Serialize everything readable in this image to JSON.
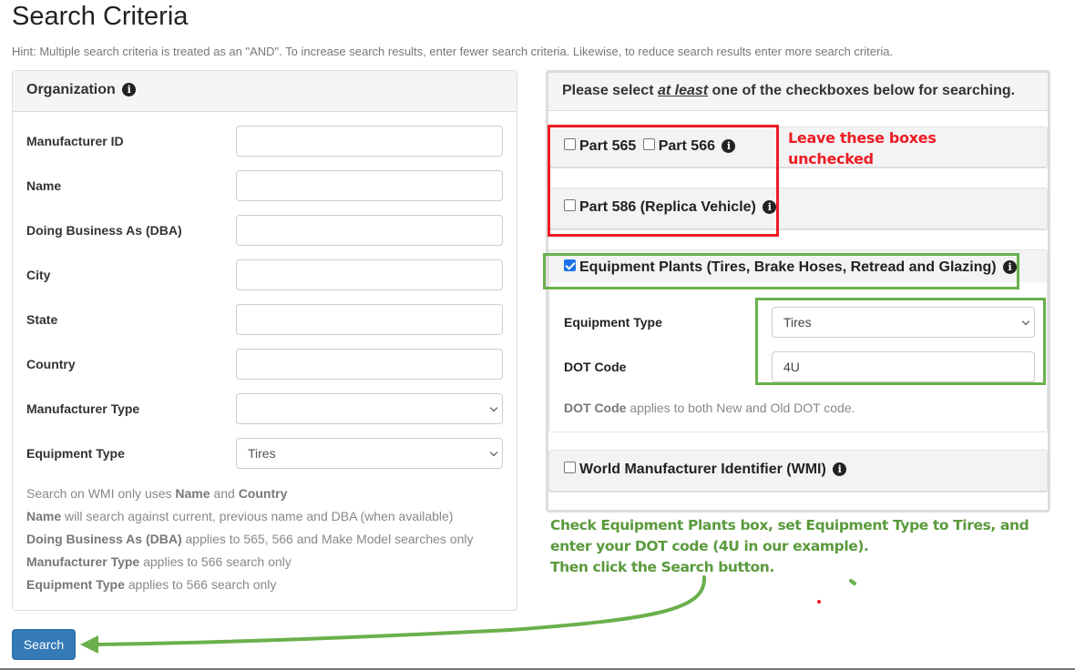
{
  "page": {
    "title": "Search Criteria",
    "hint": "Hint: Multiple search criteria is treated as an \"AND\". To increase search results, enter fewer search criteria. Likewise, to reduce search results enter more search criteria."
  },
  "organization": {
    "heading": "Organization",
    "info_icon": "info-circle-icon",
    "fields": [
      {
        "label": "Manufacturer ID",
        "type": "text",
        "value": ""
      },
      {
        "label": "Name",
        "type": "text",
        "value": ""
      },
      {
        "label": "Doing Business As (DBA)",
        "type": "text",
        "value": ""
      },
      {
        "label": "City",
        "type": "text",
        "value": ""
      },
      {
        "label": "State",
        "type": "text",
        "value": ""
      },
      {
        "label": "Country",
        "type": "text",
        "value": ""
      },
      {
        "label": "Manufacturer Type",
        "type": "select",
        "value": ""
      },
      {
        "label": "Equipment Type",
        "type": "select",
        "value": "Tires"
      }
    ],
    "notes": [
      {
        "pre": "Search on WMI only uses ",
        "b1": "Name",
        "mid": " and ",
        "b2": "Country",
        "post": ""
      },
      {
        "pre": "",
        "b1": "Name",
        "mid": " will search against current, previous name and DBA (when available)",
        "b2": "",
        "post": ""
      },
      {
        "pre": "",
        "b1": "Doing Business As (DBA)",
        "mid": " applies to 565, 566 and Make Model searches only",
        "b2": "",
        "post": ""
      },
      {
        "pre": "",
        "b1": "Manufacturer Type",
        "mid": " applies to 566 search only",
        "b2": "",
        "post": ""
      },
      {
        "pre": "",
        "b1": "Equipment Type",
        "mid": " applies to 566 search only",
        "b2": "",
        "post": ""
      }
    ]
  },
  "search_button": {
    "label": "Search"
  },
  "checkbox_panel": {
    "heading_pre": "Please select ",
    "heading_emph": "at least",
    "heading_post": " one of the checkboxes below for searching.",
    "options": [
      {
        "label": "Part 565",
        "checked": false
      },
      {
        "label": "Part 566",
        "checked": false
      },
      {
        "label": "Part 586 (Replica Vehicle)",
        "checked": false
      },
      {
        "label": "Equipment Plants (Tires, Brake Hoses, Retread and Glazing)",
        "checked": true
      },
      {
        "label": "World Manufacturer Identifier (WMI)",
        "checked": false
      }
    ],
    "equipment_plants": {
      "equipment_type_label": "Equipment Type",
      "equipment_type_value": "Tires",
      "dot_code_label": "DOT Code",
      "dot_code_value": "4U",
      "note_bold": "DOT Code",
      "note_rest": " applies to both New and Old DOT code."
    }
  },
  "annotations": {
    "red_note_line1": "Leave these boxes",
    "red_note_line2": "unchecked",
    "green_note_line1": "Check Equipment Plants box, set Equipment Type to Tires, and",
    "green_note_line2": "enter your DOT code (4U in our example).",
    "green_note_line3": "Then click the Search button.",
    "colors": {
      "red": "#ee1c24",
      "green": "#6ab04c",
      "button_blue": "#337ab7"
    }
  }
}
